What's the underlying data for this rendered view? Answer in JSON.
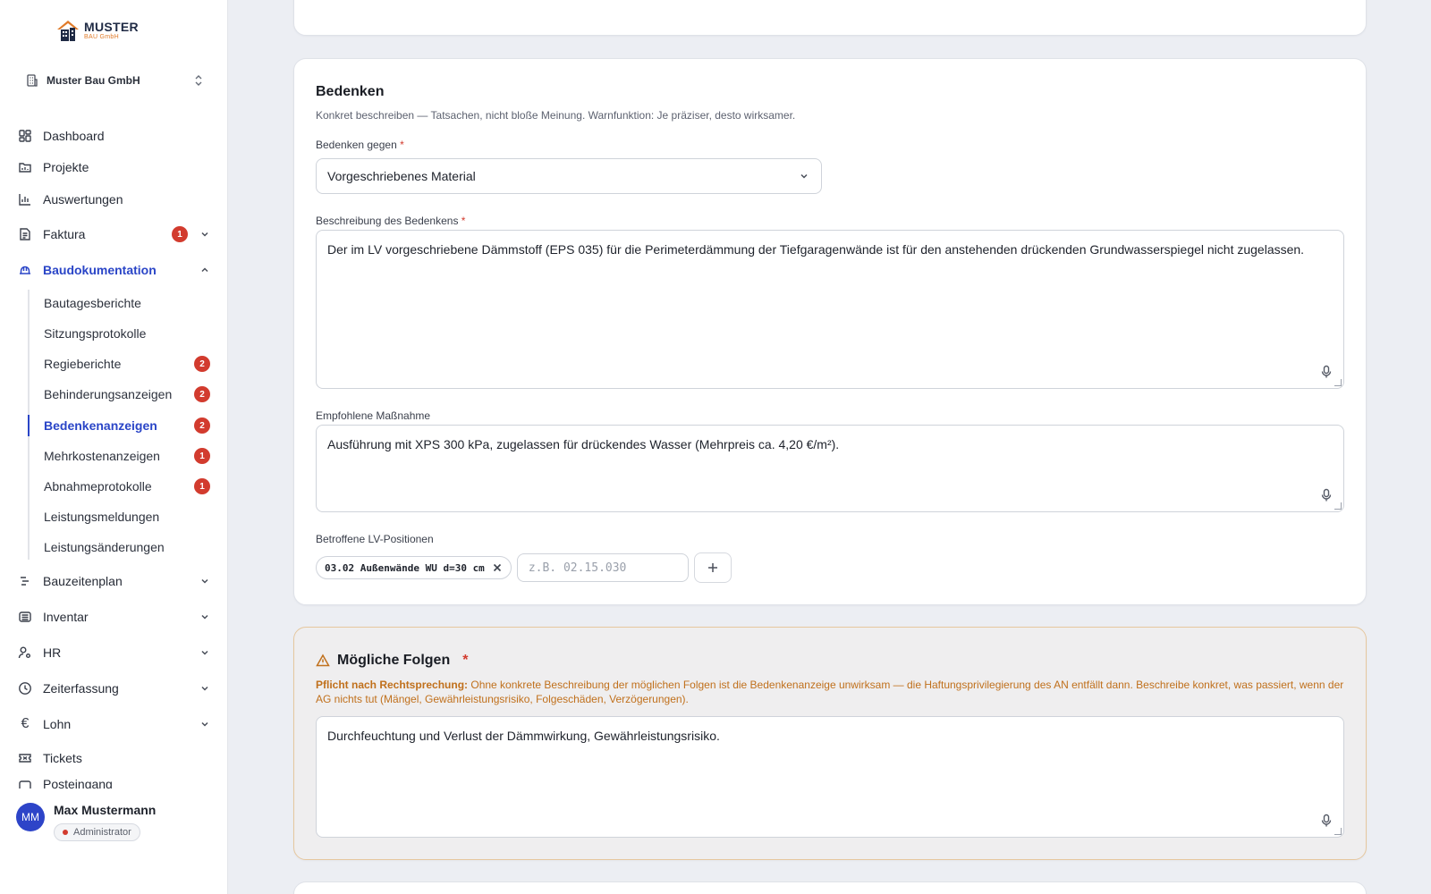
{
  "logo": {
    "main": "MUSTER",
    "sub": "BAU GmbH"
  },
  "company": {
    "name": "Muster Bau GmbH"
  },
  "nav": {
    "dashboard": "Dashboard",
    "projekte": "Projekte",
    "auswertungen": "Auswertungen",
    "faktura": {
      "label": "Faktura",
      "badge": "1"
    },
    "baudokumentation": "Baudokumentation",
    "sub": [
      {
        "label": "Bautagesberichte",
        "badge": ""
      },
      {
        "label": "Sitzungsprotokolle",
        "badge": ""
      },
      {
        "label": "Regieberichte",
        "badge": "2"
      },
      {
        "label": "Behinderungsanzeigen",
        "badge": "2"
      },
      {
        "label": "Bedenkenanzeigen",
        "badge": "2"
      },
      {
        "label": "Mehrkostenanzeigen",
        "badge": "1"
      },
      {
        "label": "Abnahmeprotokolle",
        "badge": "1"
      },
      {
        "label": "Leistungsmeldungen",
        "badge": ""
      },
      {
        "label": "Leistungsänderungen",
        "badge": ""
      }
    ],
    "bauzeitenplan": "Bauzeitenplan",
    "inventar": "Inventar",
    "hr": "HR",
    "zeiterfassung": "Zeiterfassung",
    "lohn": "Lohn",
    "tickets": "Tickets",
    "posteingang": "Posteingang"
  },
  "user": {
    "initials": "MM",
    "name": "Max Mustermann",
    "role": "Administrator"
  },
  "bedenken": {
    "title": "Bedenken",
    "help": "Konkret beschreiben — Tatsachen, nicht bloße Meinung. Warnfunktion: Je präziser, desto wirksamer.",
    "gegen_label": "Bedenken gegen",
    "gegen_value": "Vorgeschriebenes Material",
    "beschreibung_label": "Beschreibung des Bedenkens",
    "beschreibung_value": "Der im LV vorgeschriebene Dämmstoff (EPS 035) für die Perimeterdämmung der Tiefgaragenwände ist für den anstehenden drückenden Grundwasserspiegel nicht zugelassen.",
    "massnahme_label": "Empfohlene Maßnahme",
    "massnahme_value": "Ausführung mit XPS 300 kPa, zugelassen für drückendes Wasser (Mehrpreis ca. 4,20 €/m²).",
    "lv_label": "Betroffene LV-Positionen",
    "lv_tags": [
      "03.02 Außenwände WU d=30 cm"
    ],
    "lv_placeholder": "z.B. 02.15.030",
    "required_mark": "*"
  },
  "folgen": {
    "title": "Mögliche Folgen",
    "required_mark": "*",
    "warn_strong": "Pflicht nach Rechtsprechung:",
    "warn_text": " Ohne konkrete Beschreibung der möglichen Folgen ist die Bedenkenanzeige unwirksam — die Haftungsprivilegierung des AN entfällt dann. Beschreibe konkret, was passiert, wenn der AG nichts tut (Mängel, Gewährleistungsrisiko, Folgeschäden, Verzögerungen).",
    "value": "Durchfeuchtung und Verlust der Dämmwirkung, Gewährleistungsrisiko."
  },
  "colors": {
    "accent": "#2a45c7",
    "badge": "#d23b2e",
    "warning": "#c0701c",
    "warning_border": "#e6c79e"
  }
}
